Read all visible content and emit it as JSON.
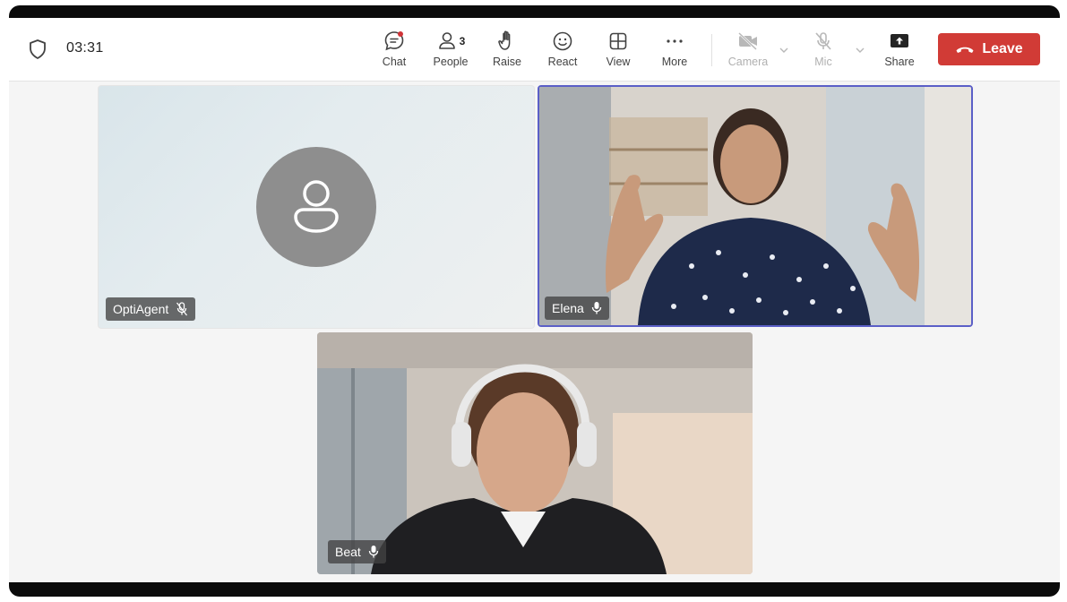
{
  "meeting": {
    "timer": "03:31"
  },
  "toolbar": {
    "chat_label": "Chat",
    "people_label": "People",
    "people_count": "3",
    "raise_label": "Raise",
    "react_label": "React",
    "view_label": "View",
    "more_label": "More",
    "camera_label": "Camera",
    "mic_label": "Mic",
    "share_label": "Share",
    "leave_label": "Leave"
  },
  "participants": [
    {
      "name": "OptiAgent",
      "mic": "muted",
      "video": "off"
    },
    {
      "name": "Elena",
      "mic": "on",
      "video": "on"
    },
    {
      "name": "Beat",
      "mic": "on",
      "video": "on"
    }
  ],
  "colors": {
    "leave": "#d13b36",
    "active_speaker_border": "#5b5fc7",
    "notification_dot": "#d13438"
  }
}
